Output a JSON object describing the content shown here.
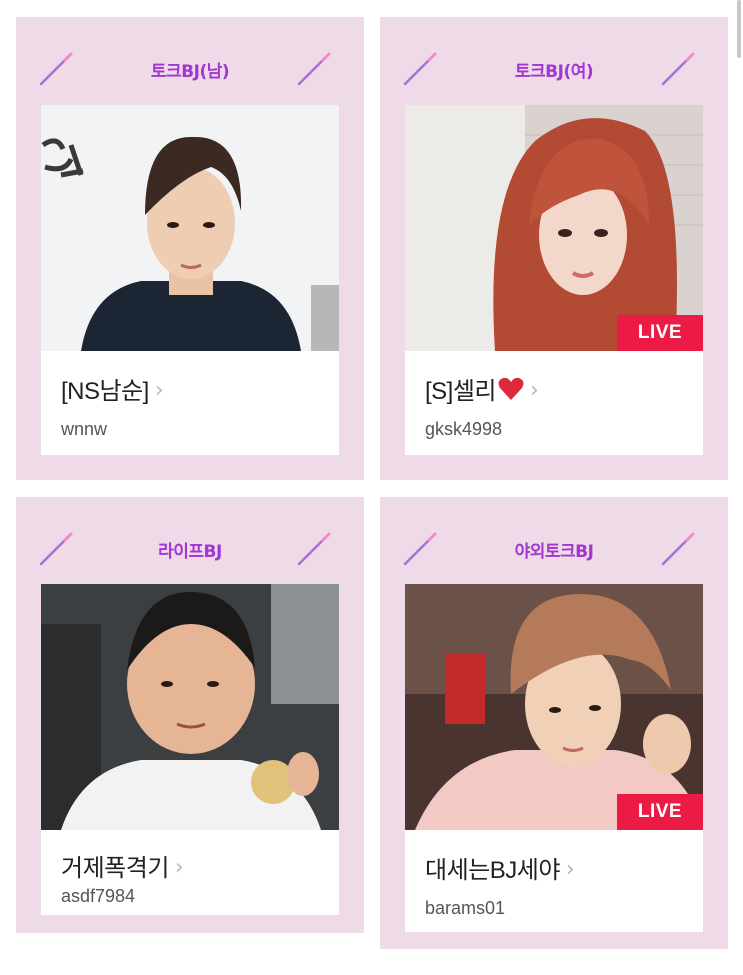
{
  "cards": [
    {
      "category": "토크BJ(남)",
      "name": "[NS남순]",
      "user_id": "wnnw",
      "live": false,
      "photo_icon": "person-photo"
    },
    {
      "category": "토크BJ(여)",
      "name": "[S]셀리",
      "user_id": "gksk4998",
      "live": true,
      "live_label": "LIVE",
      "name_icon": "heart-icon",
      "photo_icon": "person-photo"
    },
    {
      "category": "라이프BJ",
      "name": "거제폭격기",
      "user_id": "asdf7984",
      "live": false,
      "photo_icon": "person-photo"
    },
    {
      "category": "야외토크BJ",
      "name": "대세는BJ세야",
      "user_id": "barams01",
      "live": true,
      "live_label": "LIVE",
      "photo_icon": "person-photo"
    }
  ],
  "colors": {
    "card_background": "#efdbe7",
    "category_text": "#a235d4",
    "live_badge": "#ec1b45",
    "wand_icon": "#a96ee0"
  }
}
